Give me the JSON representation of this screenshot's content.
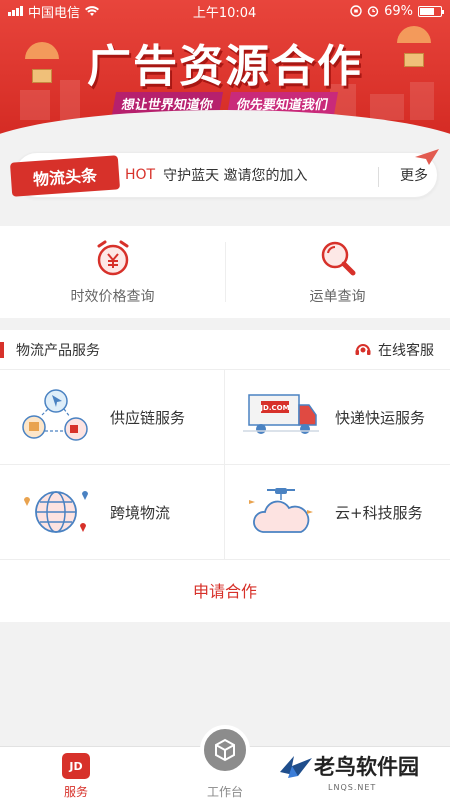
{
  "status_bar": {
    "carrier": "中国电信",
    "time": "上午10:04",
    "battery": "69%",
    "battery_level": 0.69
  },
  "banner": {
    "title": "广告资源合作",
    "ribbon_left": "想让世界知道你",
    "ribbon_right": "你先要知道我们"
  },
  "headline": {
    "badge": "物流头条",
    "hot": "HOT",
    "text": "守护蓝天 邀请您的加入",
    "more": "更多"
  },
  "quick_actions": [
    {
      "label": "时效价格查询",
      "icon": "alarm-clock-yen-icon"
    },
    {
      "label": "运单查询",
      "icon": "magnifier-icon"
    }
  ],
  "services": {
    "title": "物流产品服务",
    "support": "在线客服",
    "items": [
      {
        "label": "供应链服务",
        "icon": "supply-chain-icon"
      },
      {
        "label": "快递快运服务",
        "icon": "delivery-truck-icon"
      },
      {
        "label": "跨境物流",
        "icon": "globe-icon"
      },
      {
        "label": "云+科技服务",
        "icon": "cloud-drone-icon"
      }
    ],
    "apply": "申请合作"
  },
  "tabbar": {
    "service": "服务",
    "service_badge": "JD",
    "workbench": "工作台"
  },
  "watermark": {
    "text": "老鸟软件园",
    "sub": "LNQS.NET"
  },
  "colors": {
    "accent": "#d7312a",
    "banner_top": "#e8453c"
  }
}
